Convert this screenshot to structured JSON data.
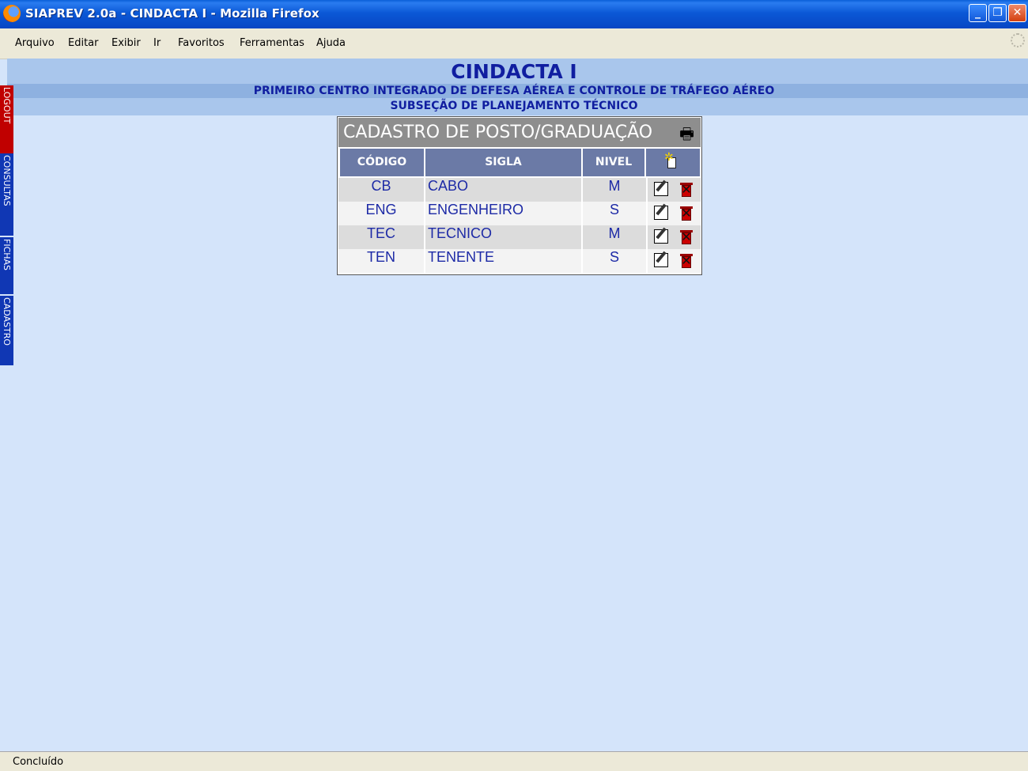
{
  "window": {
    "title": "SIAPREV 2.0a - CINDACTA I - Mozilla Firefox",
    "buttons": {
      "minimize": "_",
      "restore": "❐",
      "close": "✕"
    }
  },
  "menu": [
    "Arquivo",
    "Editar",
    "Exibir",
    "Ir",
    "Favoritos",
    "Ferramentas",
    "Ajuda"
  ],
  "header": {
    "title": "CINDACTA I",
    "subtitle": "PRIMEIRO CENTRO INTEGRADO DE DEFESA AÉREA E CONTROLE DE TRÁFEGO AÉREO",
    "section": "SUBSEÇÃO DE PLANEJAMENTO TÉCNICO"
  },
  "side_tabs": [
    {
      "label": "LOGOUT",
      "color": "#c00000"
    },
    {
      "label": "CONSULTAS",
      "color": "#1037b4"
    },
    {
      "label": "FICHAS",
      "color": "#1037b4"
    },
    {
      "label": "CADASTRO",
      "color": "#1037b4"
    }
  ],
  "panel": {
    "title": "CADASTRO DE POSTO/GRADUAÇÃO",
    "print_icon": "printer-icon",
    "columns": [
      "CÓDIGO",
      "SIGLA",
      "NIVEL"
    ],
    "new_icon": "new-document-icon",
    "rows": [
      {
        "codigo": "CB",
        "sigla": "CABO",
        "nivel": "M"
      },
      {
        "codigo": "ENG",
        "sigla": "ENGENHEIRO",
        "nivel": "S"
      },
      {
        "codigo": "TEC",
        "sigla": "TECNICO",
        "nivel": "M"
      },
      {
        "codigo": "TEN",
        "sigla": "TENENTE",
        "nivel": "S"
      }
    ]
  },
  "status": {
    "text": "Concluído"
  }
}
